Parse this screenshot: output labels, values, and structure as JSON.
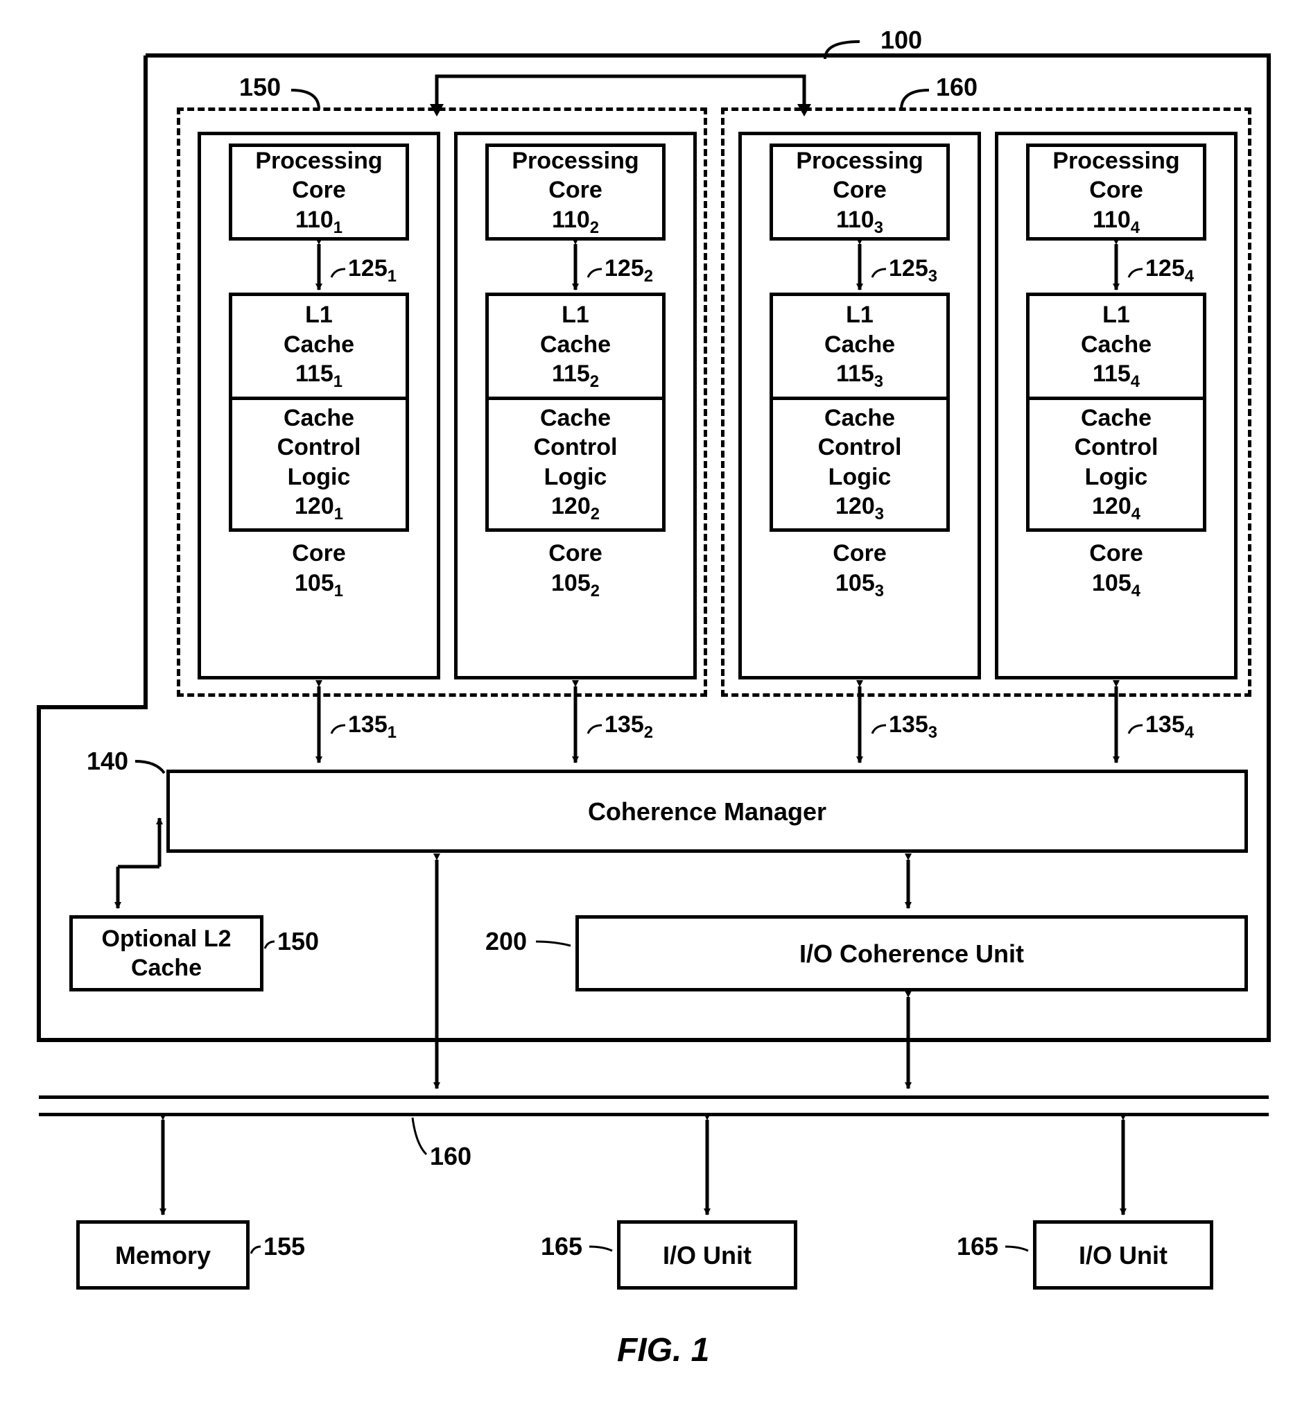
{
  "refs": {
    "system": "100",
    "cluster_l": "150",
    "cluster_r": "160",
    "cm": "140",
    "l2": "150",
    "iocu": "200",
    "bus": "160",
    "mem": "155",
    "io_a": "165",
    "io_b": "165",
    "arrow125_1": "125",
    "arrow125_2": "125",
    "arrow125_3": "125",
    "arrow125_4": "125",
    "arrow135_1": "135",
    "arrow135_2": "135",
    "arrow135_3": "135",
    "arrow135_4": "135"
  },
  "sub": {
    "1": "1",
    "2": "2",
    "3": "3",
    "4": "4"
  },
  "blocks": {
    "pcore": {
      "t1": "Processing",
      "t2": "Core",
      "num": "110"
    },
    "l1": {
      "t1": "L1",
      "t2": "Cache",
      "num": "115"
    },
    "ccl": {
      "t1": "Cache",
      "t2": "Control",
      "t3": "Logic",
      "num": "120"
    },
    "core": {
      "t1": "Core",
      "num": "105"
    },
    "cm": {
      "t": "Coherence Manager"
    },
    "l2": {
      "t1": "Optional L2",
      "t2": "Cache"
    },
    "iocu": {
      "t": "I/O Coherence Unit"
    },
    "mem": {
      "t": "Memory"
    },
    "io": {
      "t": "I/O Unit"
    }
  },
  "fig": "FIG. 1"
}
